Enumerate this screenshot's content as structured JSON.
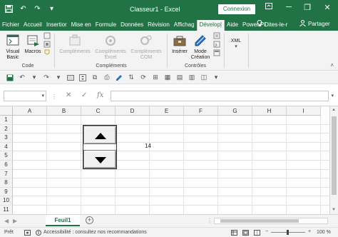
{
  "window": {
    "title": "Classeur1 - Excel",
    "connexion_label": "Connexion",
    "minimize": "─",
    "restore": "❐",
    "close": "✕"
  },
  "qat": {
    "save_icon": "save-icon",
    "undo_icon": "undo-icon",
    "redo_icon": "redo-icon"
  },
  "tabs": [
    {
      "label": "Fichier"
    },
    {
      "label": "Accueil"
    },
    {
      "label": "Insertior"
    },
    {
      "label": "Mise en"
    },
    {
      "label": "Formule"
    },
    {
      "label": "Données"
    },
    {
      "label": "Révision"
    },
    {
      "label": "Affichag"
    },
    {
      "label": "Dévelop|"
    },
    {
      "label": "Aide"
    },
    {
      "label": "Power Pi"
    }
  ],
  "tab_right": {
    "tell_me": "Dites-le-r",
    "share": "Partager"
  },
  "ribbon": {
    "visual_basic": "Visual Basic",
    "macros": "Macros",
    "code_group": "Code",
    "complements": "Compléments",
    "complements_excel": "Compléments Excel",
    "complements_com": "Compléments COM",
    "complements_group": "Compléments",
    "inserer": "Insérer",
    "mode_creation": "Mode Création",
    "controles_group": "Contrôles",
    "xml": "XML"
  },
  "formula_bar": {
    "name_box": "",
    "cancel": "✕",
    "enter": "✓",
    "fx": "fx",
    "formula": ""
  },
  "columns": [
    "A",
    "B",
    "C",
    "D",
    "E",
    "F",
    "G",
    "H",
    "I"
  ],
  "rows": [
    "1",
    "2",
    "3",
    "4",
    "5",
    "6",
    "7",
    "8",
    "9",
    "10",
    "11"
  ],
  "cells": {
    "D4": "14"
  },
  "sheet": {
    "tab_name": "Feuil1",
    "add": "+"
  },
  "status": {
    "ready": "Prêt",
    "accessibility": "Accessibilité : consultez nos recommandations",
    "zoom": "100 %"
  },
  "colors": {
    "brand": "#217346",
    "ribbon_bg": "#f3f3f3"
  }
}
